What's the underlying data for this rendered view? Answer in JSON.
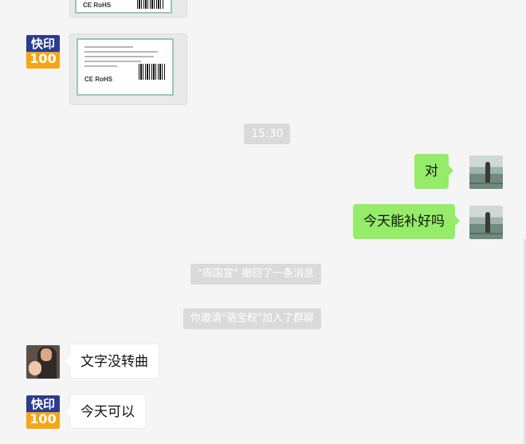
{
  "messages": [
    {
      "type": "image",
      "sender": "other",
      "label_bottom": "CE RoHS"
    },
    {
      "type": "image",
      "sender": "other",
      "label_bottom": "CE RoHS"
    },
    {
      "type": "time",
      "text": "15:30"
    },
    {
      "type": "text",
      "sender": "me",
      "text": "对"
    },
    {
      "type": "text",
      "sender": "me",
      "text": "今天能补好吗"
    },
    {
      "type": "system",
      "text": "\"周国宣\" 撤回了一条消息"
    },
    {
      "type": "system",
      "text": "你邀请\"骆宝权\"加入了群聊"
    },
    {
      "type": "text",
      "sender": "other",
      "text": "文字没转曲"
    },
    {
      "type": "text",
      "sender": "other",
      "text": "今天可以"
    }
  ],
  "avatars": {
    "logo": {
      "top_text": "快印",
      "bottom_text": "100",
      "colors": {
        "top": "#2a3c8c",
        "bottom": "#f5a615"
      }
    }
  },
  "colors": {
    "me_bubble": "#95ec69",
    "other_bubble": "#ffffff",
    "background": "#f5f5f5",
    "system_bg": "#dadada"
  }
}
